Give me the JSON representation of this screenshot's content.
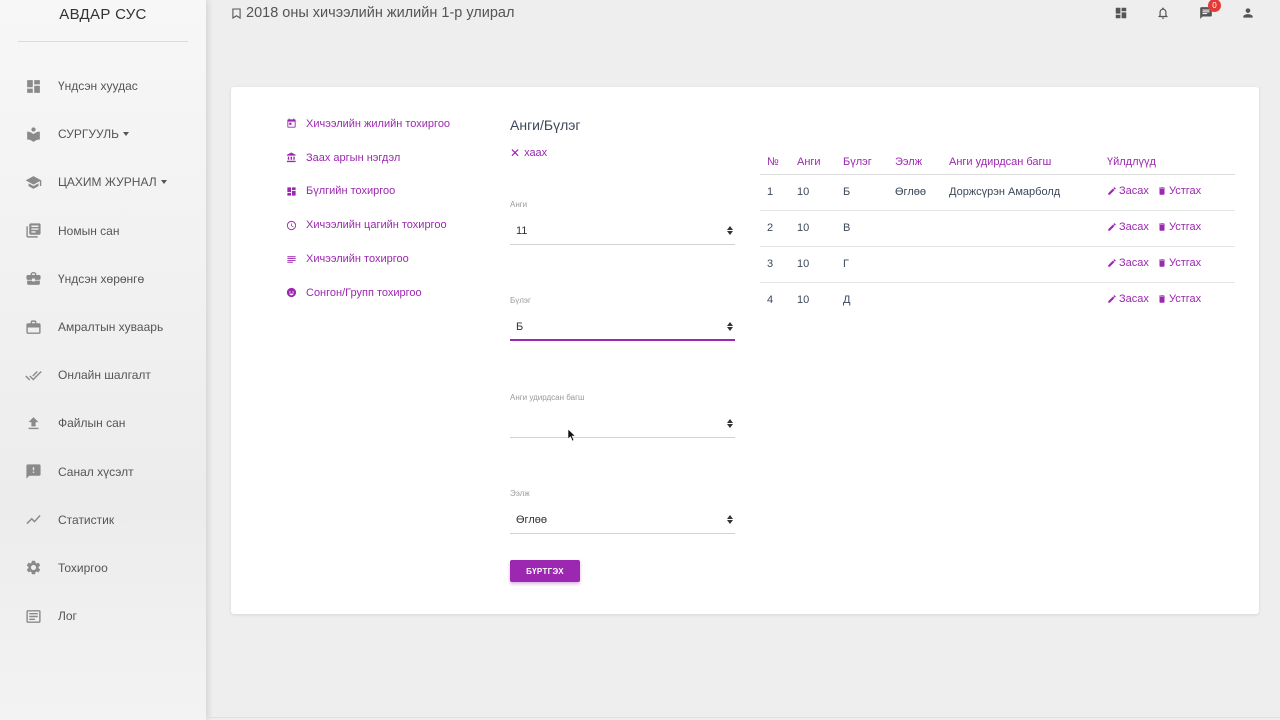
{
  "sidebar": {
    "brand": "АВДАР СУС",
    "items": [
      {
        "label": "Үндсэн хуудас",
        "icon": "dashboard-icon",
        "caret": false
      },
      {
        "label": "СУРГУУЛЬ",
        "icon": "school-book-icon",
        "caret": true
      },
      {
        "label": "ЦАХИМ ЖУРНАЛ",
        "icon": "graduation-cap-icon",
        "caret": true
      },
      {
        "label": "Номын сан",
        "icon": "library-books-icon",
        "caret": false
      },
      {
        "label": "Үндсэн хөрөнгө",
        "icon": "briefcase-icon",
        "caret": false
      },
      {
        "label": "Амралтын хуваарь",
        "icon": "work-case-icon",
        "caret": false
      },
      {
        "label": "Онлайн шалгалт",
        "icon": "double-check-icon",
        "caret": false
      },
      {
        "label": "Файлын сан",
        "icon": "upload-icon",
        "caret": false
      },
      {
        "label": "Санал хүсэлт",
        "icon": "feedback-icon",
        "caret": false
      },
      {
        "label": "Статистик",
        "icon": "trending-chart-icon",
        "caret": false
      },
      {
        "label": "Тохиргоо",
        "icon": "gear-icon",
        "caret": false
      },
      {
        "label": "Лог",
        "icon": "list-log-icon",
        "caret": false
      }
    ]
  },
  "header": {
    "title": "2018 оны хичээлийн жилийн 1-р улирал",
    "notification_count": "0"
  },
  "settings_menu": [
    {
      "label": "Хичээлийн жилийн тохиргоо",
      "icon": "calendar-icon"
    },
    {
      "label": "Заах аргын нэгдэл",
      "icon": "bank-icon"
    },
    {
      "label": "Бүлгийн тохиргоо",
      "icon": "grid-icon"
    },
    {
      "label": "Хичээлийн цагийн тохиргоо",
      "icon": "clock-icon"
    },
    {
      "label": "Хичээлийн тохиргоо",
      "icon": "lines-icon"
    },
    {
      "label": "Сонгон/Групп тохиргоо",
      "icon": "group-icon"
    }
  ],
  "form": {
    "title": "Анги/Бүлэг",
    "close_label": "хаах",
    "fields": {
      "grade": {
        "label": "Анги",
        "value": "11"
      },
      "group": {
        "label": "Бүлэг",
        "value": "Б"
      },
      "teacher": {
        "label": "Анги удирдсан багш",
        "value": ""
      },
      "shift": {
        "label": "Ээлж",
        "value": "Өглөө"
      }
    },
    "submit_label": "БҮРТГЭХ"
  },
  "table": {
    "headers": [
      "№",
      "Анги",
      "Бүлэг",
      "Ээлж",
      "Анги удирдсан багш",
      "Үйлдлүүд"
    ],
    "edit_label": "Засах",
    "delete_label": "Устгах",
    "rows": [
      {
        "no": "1",
        "grade": "10",
        "group": "Б",
        "shift": "Өглөө",
        "teacher": "Доржсүрэн Амарболд"
      },
      {
        "no": "2",
        "grade": "10",
        "group": "В",
        "shift": "",
        "teacher": ""
      },
      {
        "no": "3",
        "grade": "10",
        "group": "Г",
        "shift": "",
        "teacher": ""
      },
      {
        "no": "4",
        "grade": "10",
        "group": "Д",
        "shift": "",
        "teacher": ""
      }
    ]
  },
  "colors": {
    "accent": "#9c27b0",
    "badge": "#e53935"
  }
}
